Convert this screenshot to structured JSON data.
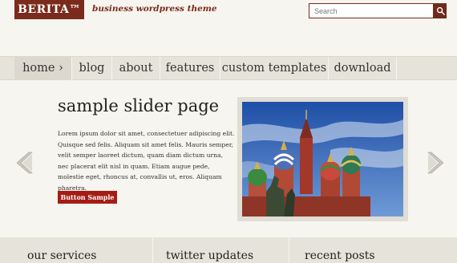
{
  "header": {
    "logo": "BERITA™",
    "tagline": "business wordpress theme",
    "search_placeholder": "Search"
  },
  "nav": {
    "items": [
      {
        "label": "home ›"
      },
      {
        "label": "blog"
      },
      {
        "label": "about"
      },
      {
        "label": "features"
      },
      {
        "label": "custom templates"
      },
      {
        "label": "download"
      }
    ]
  },
  "slider": {
    "title": "sample slider page",
    "body": "Lorem ipsum dolor sit amet, consectetuer adipiscing elit. Quisque sed felis. Aliquam sit amet felis. Mauris semper, velit semper laoreet dictum, quam diam dictum urna, nec placerat elit nisl in quam. Etiam augue pede, molestie eget, rhoncus at, convallis ut, eros. Aliquam pharetra.",
    "button": "Button Sample"
  },
  "widgets": [
    {
      "title": "our services"
    },
    {
      "title": "twitter updates"
    },
    {
      "title": "recent posts"
    }
  ],
  "colors": {
    "brand": "#7a2b1c",
    "button": "#a51c15",
    "nav_bg": "#e6e3da",
    "page_bg": "#f7f5ef"
  }
}
